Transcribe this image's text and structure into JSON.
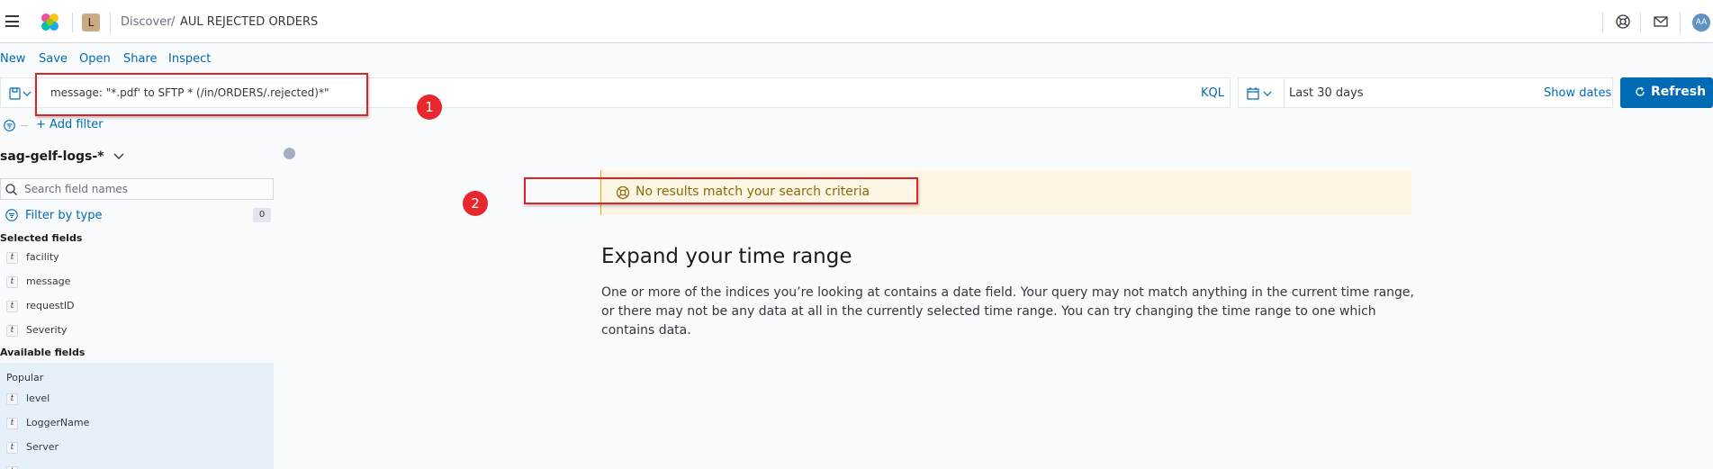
{
  "header": {
    "space_initial": "L",
    "breadcrumb_app": "Discover",
    "breadcrumb_sep": "/",
    "breadcrumb_current": "AUL REJECTED ORDERS",
    "avatar_initials": "AA"
  },
  "topnav": {
    "new": "New",
    "save": "Save",
    "open": "Open",
    "share": "Share",
    "inspect": "Inspect"
  },
  "query": {
    "value": "message: \"*.pdf' to SFTP * (/in/ORDERS/.rejected)*\"",
    "language": "KQL"
  },
  "date": {
    "range": "Last 30 days",
    "show_dates": "Show dates"
  },
  "refresh_label": "Refresh",
  "add_filter": "+ Add filter",
  "sidebar": {
    "index_pattern": "sag-gelf-logs-*",
    "search_placeholder": "Search field names",
    "filter_by_type": "Filter by type",
    "filter_count": "0",
    "selected_title": "Selected fields",
    "selected": [
      "facility",
      "message",
      "requestID",
      "Severity"
    ],
    "available_title": "Available fields",
    "popular_label": "Popular",
    "popular": [
      "level",
      "LoggerName",
      "Server"
    ],
    "field_type_token": "t"
  },
  "main": {
    "callout": "No results match your search criteria",
    "expand_title": "Expand your time range",
    "expand_body": "One or more of the indices you’re looking at contains a date field. Your query may not match anything in the current time range, or there may not be any data at all in the currently selected time range. You can try changing the time range to one which contains data."
  },
  "annotations": {
    "marker1": "1",
    "marker2": "2",
    "color": "#d9252a"
  },
  "colors": {
    "link": "#006bb4",
    "primary": "#006bb4",
    "callout_bg": "#fef6e5",
    "callout_border": "#f5a700"
  }
}
